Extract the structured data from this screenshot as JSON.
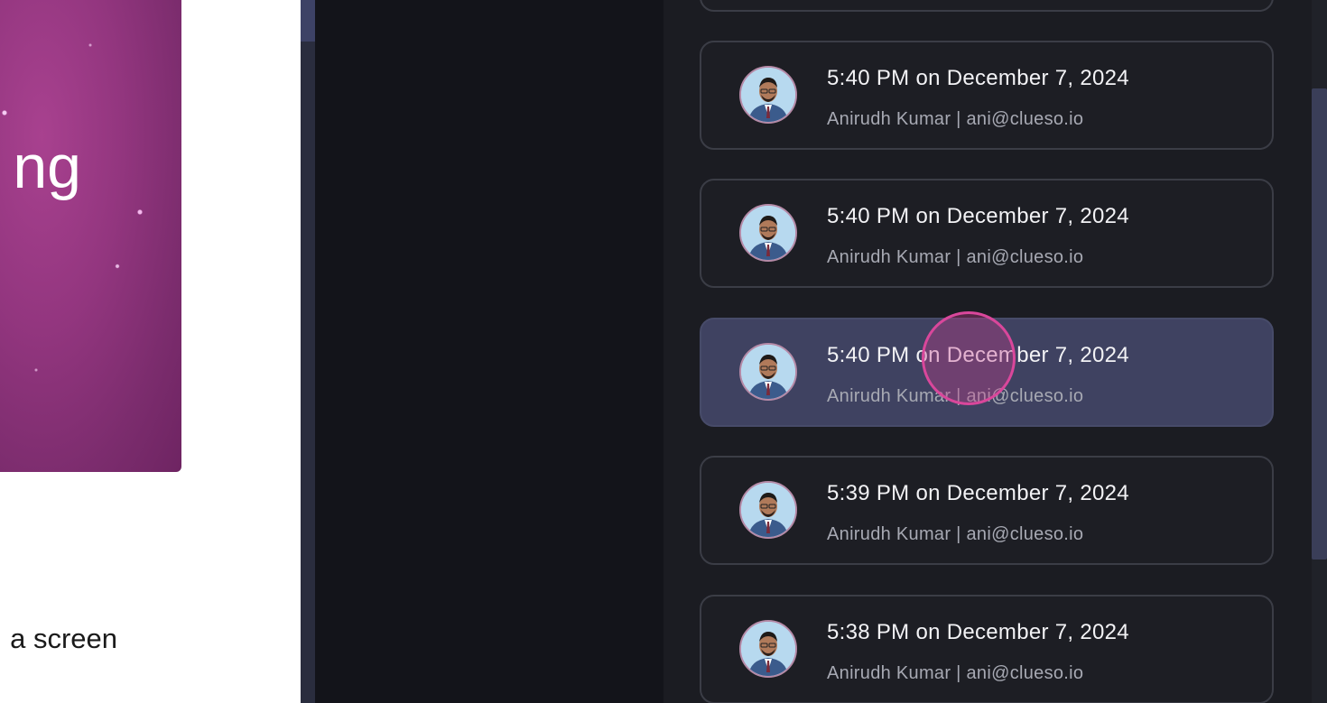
{
  "left_page": {
    "hero_text": "ng",
    "caption": "a screen"
  },
  "versions": [
    {
      "title": "",
      "subtitle": ""
    },
    {
      "title": "5:40 PM on December 7, 2024",
      "subtitle": "Anirudh Kumar | ani@clueso.io"
    },
    {
      "title": "5:40 PM on December 7, 2024",
      "subtitle": "Anirudh Kumar | ani@clueso.io"
    },
    {
      "title": "5:40 PM on December 7, 2024",
      "subtitle": "Anirudh Kumar | ani@clueso.io"
    },
    {
      "title": "5:39 PM on December 7, 2024",
      "subtitle": "Anirudh Kumar | ani@clueso.io"
    },
    {
      "title": "5:38 PM on December 7, 2024",
      "subtitle": "Anirudh Kumar | ani@clueso.io"
    }
  ],
  "active_index": 3,
  "colors": {
    "accent": "#d9479b",
    "active_card": "#3f4261",
    "hero": "#93367f"
  }
}
